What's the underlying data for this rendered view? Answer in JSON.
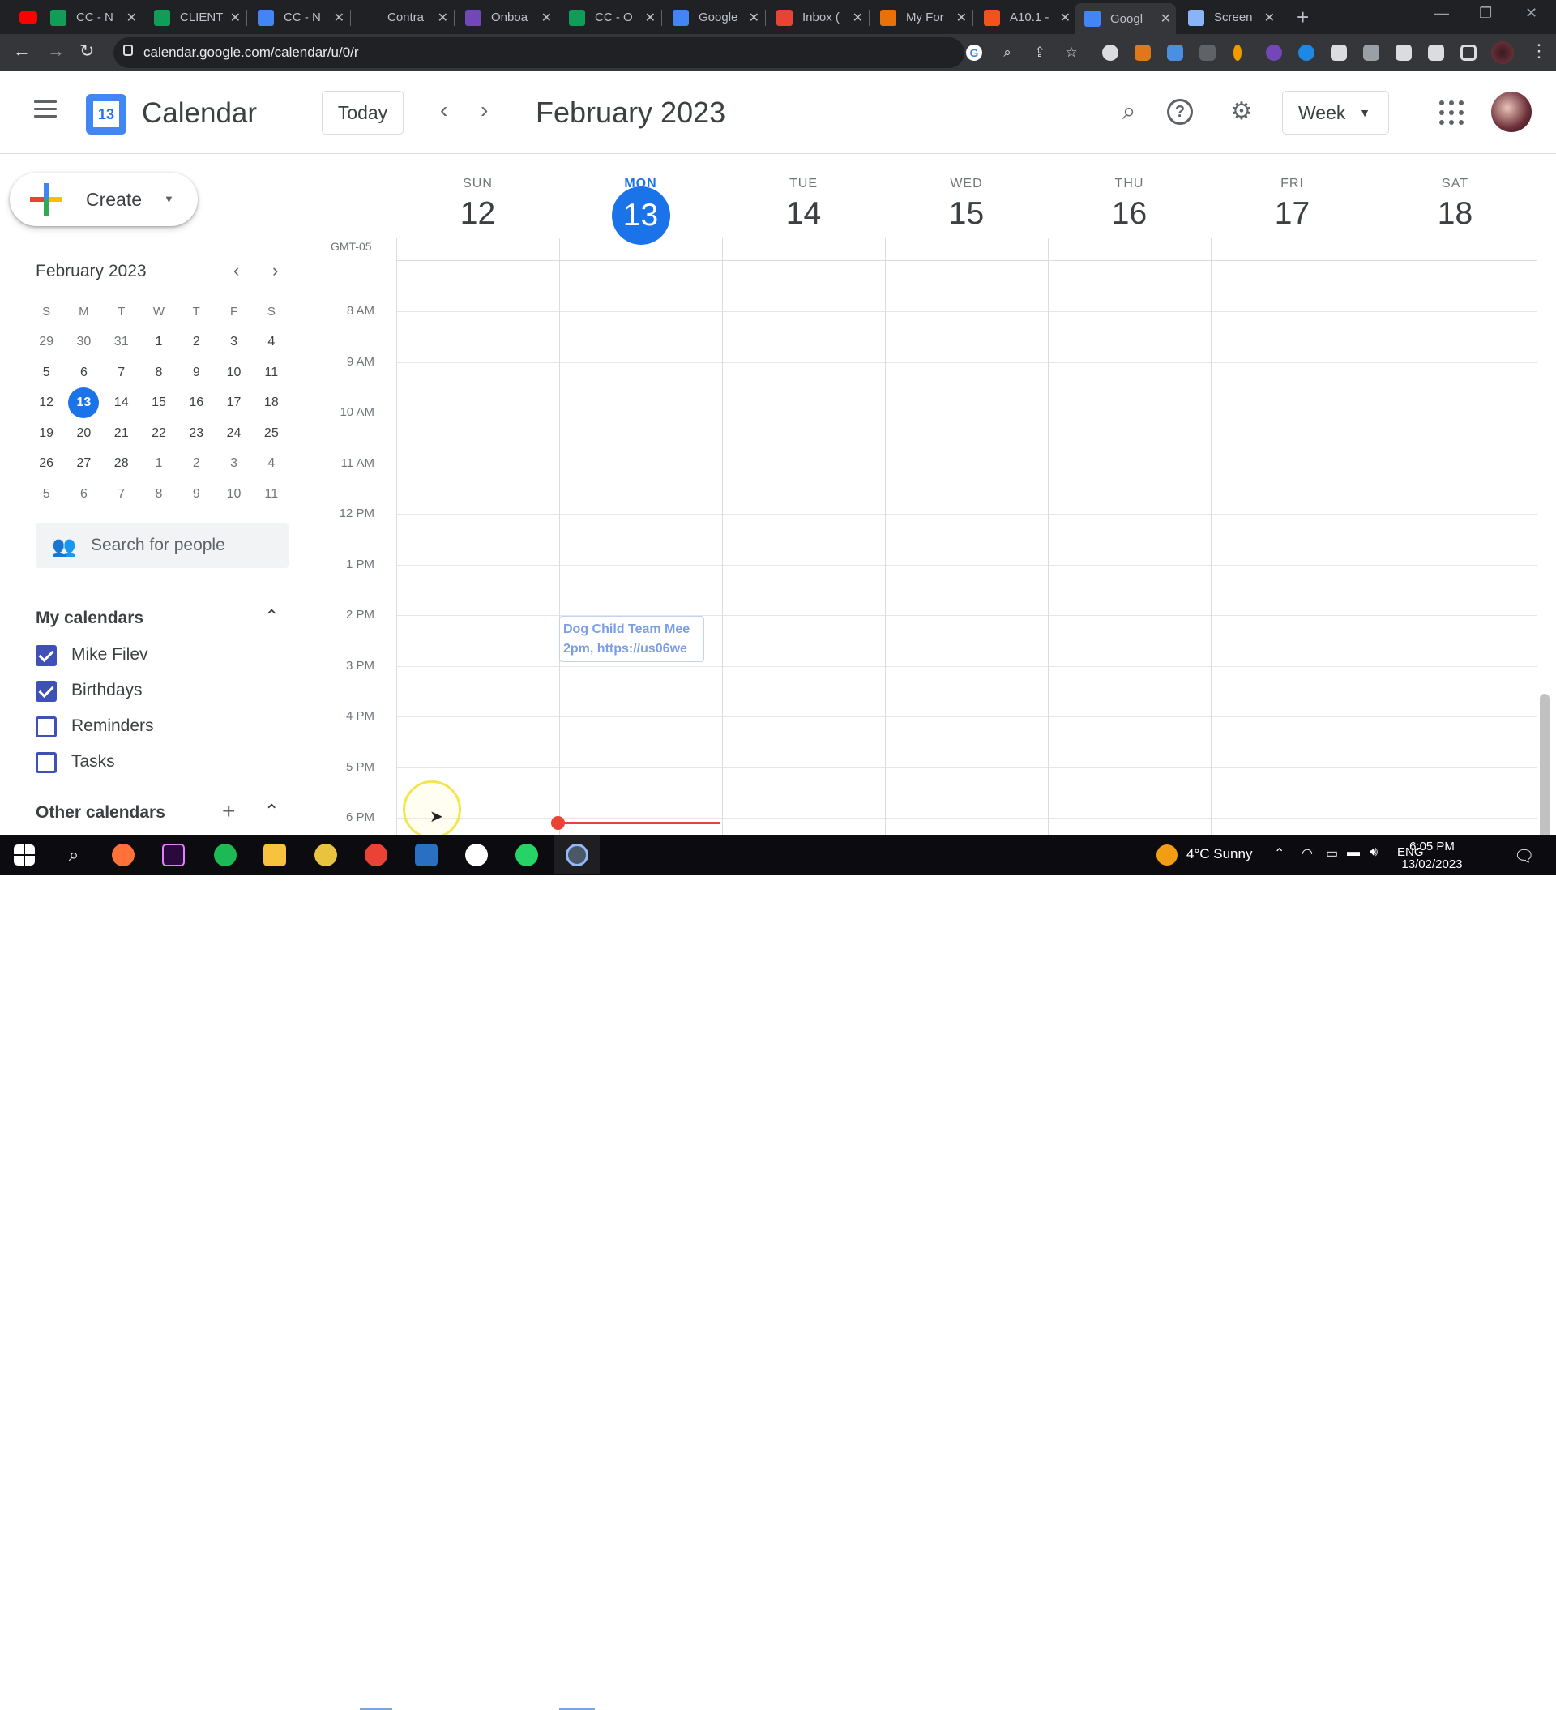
{
  "browser": {
    "tabs": [
      {
        "title": "CC - N",
        "color": "#0f9d58",
        "icon": "sheets-icon"
      },
      {
        "title": "CLIENT",
        "color": "#0f9d58",
        "icon": "sheets-icon"
      },
      {
        "title": "CC - N",
        "color": "#4285f4",
        "icon": "docs-icon"
      },
      {
        "title": "Contra",
        "color": "#202124",
        "icon": "blank-icon"
      },
      {
        "title": "Onboa",
        "color": "#7248b9",
        "icon": "forms-icon"
      },
      {
        "title": "CC - O",
        "color": "#0f9d58",
        "icon": "sheets-icon"
      },
      {
        "title": "Google",
        "color": "#4285f4",
        "icon": "calendar-icon"
      },
      {
        "title": "Inbox (",
        "color": "#ea4335",
        "icon": "gmail-icon"
      },
      {
        "title": "My For",
        "color": "#e8710a",
        "icon": "pen-icon"
      },
      {
        "title": "A10.1 -",
        "color": "#f4511e",
        "icon": "slides-icon"
      },
      {
        "title": "Googl",
        "color": "#4285f4",
        "icon": "calendar-icon"
      },
      {
        "title": "Screen",
        "color": "#8ab4f8",
        "icon": "record-icon"
      }
    ],
    "url": "calendar.google.com/calendar/u/0/r"
  },
  "header": {
    "app_title": "Calendar",
    "logo_day": "13",
    "today_label": "Today",
    "month_title": "February 2023",
    "view_label": "Week"
  },
  "sidebar": {
    "create_label": "Create",
    "mini_title": "February 2023",
    "weekday_heads": [
      "S",
      "M",
      "T",
      "W",
      "T",
      "F",
      "S"
    ],
    "mini_weeks": [
      [
        "29",
        "30",
        "31",
        "1",
        "2",
        "3",
        "4"
      ],
      [
        "5",
        "6",
        "7",
        "8",
        "9",
        "10",
        "11"
      ],
      [
        "12",
        "13",
        "14",
        "15",
        "16",
        "17",
        "18"
      ],
      [
        "19",
        "20",
        "21",
        "22",
        "23",
        "24",
        "25"
      ],
      [
        "26",
        "27",
        "28",
        "1",
        "2",
        "3",
        "4"
      ],
      [
        "5",
        "6",
        "7",
        "8",
        "9",
        "10",
        "11"
      ]
    ],
    "mini_selected": "13",
    "people_placeholder": "Search for people",
    "my_calendars_title": "My calendars",
    "calendars": [
      {
        "label": "Mike Filev",
        "checked": true
      },
      {
        "label": "Birthdays",
        "checked": true
      },
      {
        "label": "Reminders",
        "checked": false
      },
      {
        "label": "Tasks",
        "checked": false
      }
    ],
    "other_calendars_title": "Other calendars"
  },
  "week": {
    "timezone": "GMT-05",
    "days": [
      {
        "dow": "SUN",
        "num": "12"
      },
      {
        "dow": "MON",
        "num": "13",
        "today": true
      },
      {
        "dow": "TUE",
        "num": "14"
      },
      {
        "dow": "WED",
        "num": "15"
      },
      {
        "dow": "THU",
        "num": "16"
      },
      {
        "dow": "FRI",
        "num": "17"
      },
      {
        "dow": "SAT",
        "num": "18"
      }
    ],
    "hours": [
      "8 AM",
      "9 AM",
      "10 AM",
      "11 AM",
      "12 PM",
      "1 PM",
      "2 PM",
      "3 PM",
      "4 PM",
      "5 PM",
      "6 PM"
    ],
    "event": {
      "title": "Dog Child Team Mee",
      "subtitle": "2pm, https://us06we"
    }
  },
  "taskbar": {
    "weather": "4°C  Sunny",
    "lang": "ENG",
    "time": "6:05 PM",
    "date": "13/02/2023"
  }
}
